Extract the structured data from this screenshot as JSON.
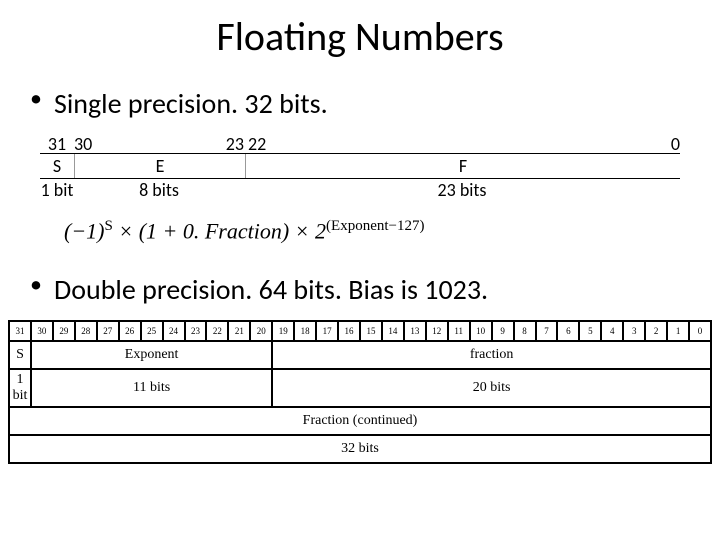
{
  "title": "Floating Numbers",
  "bullet1": "Single precision. 32 bits.",
  "sp": {
    "bits": {
      "b31": "31",
      "b30": "30",
      "b23": "23",
      "b22": "22",
      "b0": "0"
    },
    "fields": {
      "s": "S",
      "e": "E",
      "f": "F"
    },
    "widths": {
      "s": "1 bit",
      "e": "8 bits",
      "f": "23 bits"
    }
  },
  "formula": {
    "left1": "(−1)",
    "sup1": "S",
    "mid": " × (1 + 0. Fraction) × 2",
    "sup2": "(Exponent−127)"
  },
  "bullet2": "Double precision. 64 bits. Bias is 1023.",
  "dp": {
    "bits": [
      "31",
      "30",
      "29",
      "28",
      "27",
      "26",
      "25",
      "24",
      "23",
      "22",
      "21",
      "20",
      "19",
      "18",
      "17",
      "16",
      "15",
      "14",
      "13",
      "12",
      "11",
      "10",
      "9",
      "8",
      "7",
      "6",
      "5",
      "4",
      "3",
      "2",
      "1",
      "0"
    ],
    "labels": {
      "s": "S",
      "exp": "Exponent",
      "frac": "fraction"
    },
    "widths": {
      "s": "1 bit",
      "exp": "11 bits",
      "frac": "20 bits"
    },
    "continued": "Fraction (continued)",
    "continued_width": "32 bits"
  }
}
